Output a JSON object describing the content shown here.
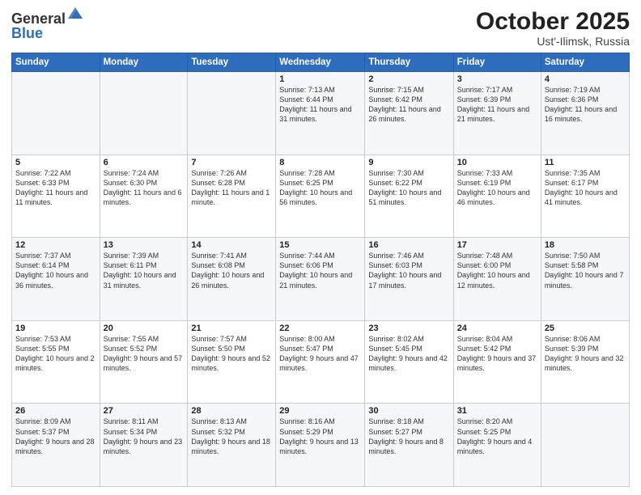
{
  "header": {
    "logo_general": "General",
    "logo_blue": "Blue",
    "title": "October 2025",
    "location": "Ust'-Ilimsk, Russia"
  },
  "days_of_week": [
    "Sunday",
    "Monday",
    "Tuesday",
    "Wednesday",
    "Thursday",
    "Friday",
    "Saturday"
  ],
  "weeks": [
    [
      {
        "day": "",
        "info": ""
      },
      {
        "day": "",
        "info": ""
      },
      {
        "day": "",
        "info": ""
      },
      {
        "day": "1",
        "info": "Sunrise: 7:13 AM\nSunset: 6:44 PM\nDaylight: 11 hours and 31 minutes."
      },
      {
        "day": "2",
        "info": "Sunrise: 7:15 AM\nSunset: 6:42 PM\nDaylight: 11 hours and 26 minutes."
      },
      {
        "day": "3",
        "info": "Sunrise: 7:17 AM\nSunset: 6:39 PM\nDaylight: 11 hours and 21 minutes."
      },
      {
        "day": "4",
        "info": "Sunrise: 7:19 AM\nSunset: 6:36 PM\nDaylight: 11 hours and 16 minutes."
      }
    ],
    [
      {
        "day": "5",
        "info": "Sunrise: 7:22 AM\nSunset: 6:33 PM\nDaylight: 11 hours and 11 minutes."
      },
      {
        "day": "6",
        "info": "Sunrise: 7:24 AM\nSunset: 6:30 PM\nDaylight: 11 hours and 6 minutes."
      },
      {
        "day": "7",
        "info": "Sunrise: 7:26 AM\nSunset: 6:28 PM\nDaylight: 11 hours and 1 minute."
      },
      {
        "day": "8",
        "info": "Sunrise: 7:28 AM\nSunset: 6:25 PM\nDaylight: 10 hours and 56 minutes."
      },
      {
        "day": "9",
        "info": "Sunrise: 7:30 AM\nSunset: 6:22 PM\nDaylight: 10 hours and 51 minutes."
      },
      {
        "day": "10",
        "info": "Sunrise: 7:33 AM\nSunset: 6:19 PM\nDaylight: 10 hours and 46 minutes."
      },
      {
        "day": "11",
        "info": "Sunrise: 7:35 AM\nSunset: 6:17 PM\nDaylight: 10 hours and 41 minutes."
      }
    ],
    [
      {
        "day": "12",
        "info": "Sunrise: 7:37 AM\nSunset: 6:14 PM\nDaylight: 10 hours and 36 minutes."
      },
      {
        "day": "13",
        "info": "Sunrise: 7:39 AM\nSunset: 6:11 PM\nDaylight: 10 hours and 31 minutes."
      },
      {
        "day": "14",
        "info": "Sunrise: 7:41 AM\nSunset: 6:08 PM\nDaylight: 10 hours and 26 minutes."
      },
      {
        "day": "15",
        "info": "Sunrise: 7:44 AM\nSunset: 6:06 PM\nDaylight: 10 hours and 21 minutes."
      },
      {
        "day": "16",
        "info": "Sunrise: 7:46 AM\nSunset: 6:03 PM\nDaylight: 10 hours and 17 minutes."
      },
      {
        "day": "17",
        "info": "Sunrise: 7:48 AM\nSunset: 6:00 PM\nDaylight: 10 hours and 12 minutes."
      },
      {
        "day": "18",
        "info": "Sunrise: 7:50 AM\nSunset: 5:58 PM\nDaylight: 10 hours and 7 minutes."
      }
    ],
    [
      {
        "day": "19",
        "info": "Sunrise: 7:53 AM\nSunset: 5:55 PM\nDaylight: 10 hours and 2 minutes."
      },
      {
        "day": "20",
        "info": "Sunrise: 7:55 AM\nSunset: 5:52 PM\nDaylight: 9 hours and 57 minutes."
      },
      {
        "day": "21",
        "info": "Sunrise: 7:57 AM\nSunset: 5:50 PM\nDaylight: 9 hours and 52 minutes."
      },
      {
        "day": "22",
        "info": "Sunrise: 8:00 AM\nSunset: 5:47 PM\nDaylight: 9 hours and 47 minutes."
      },
      {
        "day": "23",
        "info": "Sunrise: 8:02 AM\nSunset: 5:45 PM\nDaylight: 9 hours and 42 minutes."
      },
      {
        "day": "24",
        "info": "Sunrise: 8:04 AM\nSunset: 5:42 PM\nDaylight: 9 hours and 37 minutes."
      },
      {
        "day": "25",
        "info": "Sunrise: 8:06 AM\nSunset: 5:39 PM\nDaylight: 9 hours and 32 minutes."
      }
    ],
    [
      {
        "day": "26",
        "info": "Sunrise: 8:09 AM\nSunset: 5:37 PM\nDaylight: 9 hours and 28 minutes."
      },
      {
        "day": "27",
        "info": "Sunrise: 8:11 AM\nSunset: 5:34 PM\nDaylight: 9 hours and 23 minutes."
      },
      {
        "day": "28",
        "info": "Sunrise: 8:13 AM\nSunset: 5:32 PM\nDaylight: 9 hours and 18 minutes."
      },
      {
        "day": "29",
        "info": "Sunrise: 8:16 AM\nSunset: 5:29 PM\nDaylight: 9 hours and 13 minutes."
      },
      {
        "day": "30",
        "info": "Sunrise: 8:18 AM\nSunset: 5:27 PM\nDaylight: 9 hours and 8 minutes."
      },
      {
        "day": "31",
        "info": "Sunrise: 8:20 AM\nSunset: 5:25 PM\nDaylight: 9 hours and 4 minutes."
      },
      {
        "day": "",
        "info": ""
      }
    ]
  ]
}
